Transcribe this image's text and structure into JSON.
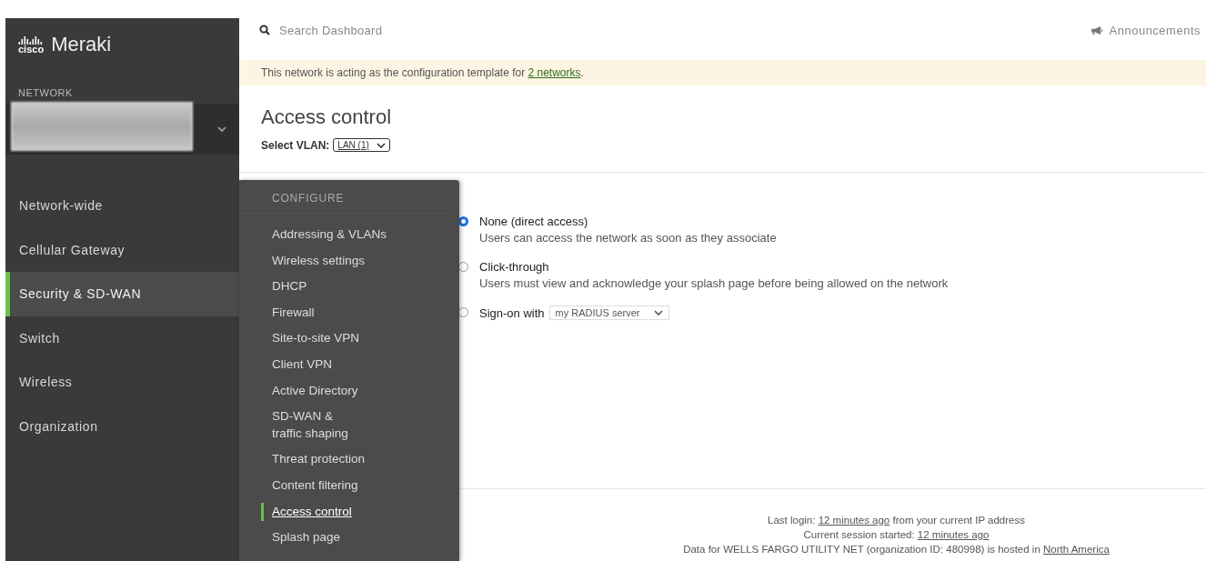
{
  "brand": {
    "logo_text": "cisco",
    "name": "Meraki"
  },
  "sidebar": {
    "section_label": "NETWORK",
    "items": [
      {
        "label": "Network-wide",
        "selected": false
      },
      {
        "label": "Cellular Gateway",
        "selected": false
      },
      {
        "label": "Security & SD-WAN",
        "selected": true
      },
      {
        "label": "Switch",
        "selected": false
      },
      {
        "label": "Wireless",
        "selected": false
      },
      {
        "label": "Organization",
        "selected": false
      }
    ]
  },
  "search": {
    "placeholder": "Search Dashboard"
  },
  "announcements": "Announcements",
  "banner": {
    "text": "This network is acting as the configuration template for ",
    "link": "2 networks",
    "suffix": "."
  },
  "page": {
    "title": "Access control",
    "vlan_label": "Select VLAN:",
    "vlan_value": "LAN (1)"
  },
  "flyout": {
    "heading": "CONFIGURE",
    "items": [
      {
        "label": "Addressing & VLANs",
        "selected": false
      },
      {
        "label": "Wireless settings",
        "selected": false
      },
      {
        "label": "DHCP",
        "selected": false
      },
      {
        "label": "Firewall",
        "selected": false
      },
      {
        "label": "Site-to-site VPN",
        "selected": false
      },
      {
        "label": "Client VPN",
        "selected": false
      },
      {
        "label": "Active Directory",
        "selected": false
      },
      {
        "label": "SD-WAN &\ntraffic shaping",
        "selected": false
      },
      {
        "label": "Threat protection",
        "selected": false
      },
      {
        "label": "Content filtering",
        "selected": false
      },
      {
        "label": "Access control",
        "selected": true
      },
      {
        "label": "Splash page",
        "selected": false
      }
    ]
  },
  "options": [
    {
      "label": "None (direct access)",
      "description": "Users can access the network as soon as they associate",
      "selected": true
    },
    {
      "label": "Click-through",
      "description": "Users must view and acknowledge your splash page before being allowed on the network",
      "selected": false
    },
    {
      "label": "Sign-on with",
      "select_value": "my RADIUS server",
      "selected": false
    }
  ],
  "footer": [
    {
      "text": "Last login: ",
      "link": "12 minutes ago",
      "suffix": " from your current IP address"
    },
    {
      "text": "Current session started: ",
      "link": "12 minutes ago"
    },
    {
      "text": "Data for WELLS FARGO UTILITY NET (organization ID: 480998) is hosted in ",
      "link": "North America"
    }
  ]
}
